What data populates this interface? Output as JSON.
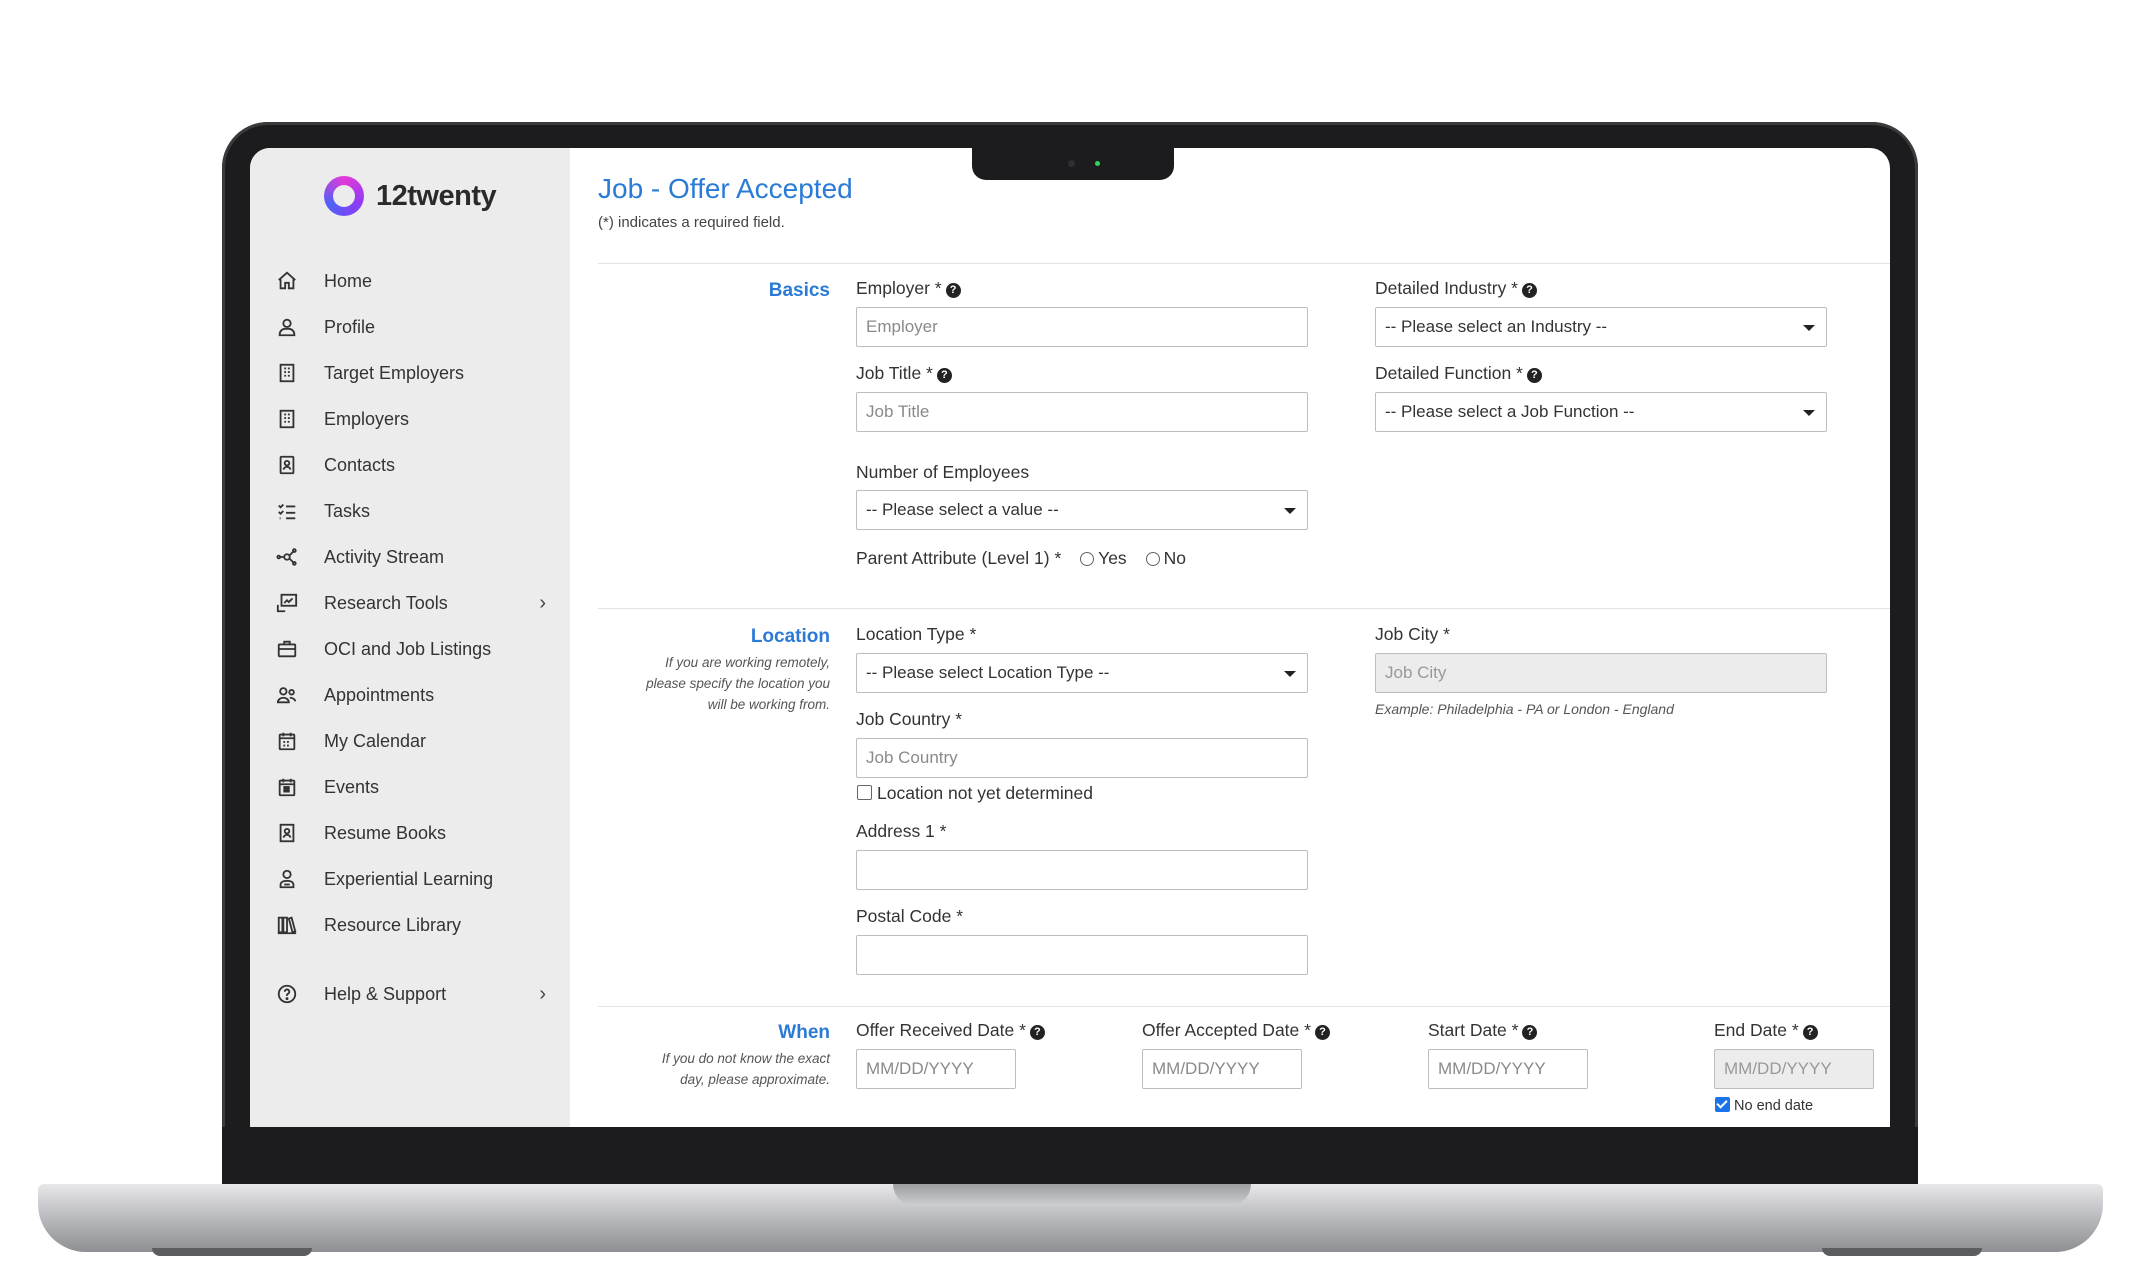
{
  "app": {
    "logo_text": "12twenty"
  },
  "sidebar": {
    "items": [
      {
        "label": "Home",
        "icon": "home-icon"
      },
      {
        "label": "Profile",
        "icon": "user-icon"
      },
      {
        "label": "Target Employers",
        "icon": "building-icon"
      },
      {
        "label": "Employers",
        "icon": "building-icon"
      },
      {
        "label": "Contacts",
        "icon": "contact-card-icon"
      },
      {
        "label": "Tasks",
        "icon": "task-list-icon"
      },
      {
        "label": "Activity Stream",
        "icon": "network-icon"
      },
      {
        "label": "Research Tools",
        "icon": "chart-screen-icon",
        "has_submenu": true
      },
      {
        "label": "OCI and Job Listings",
        "icon": "briefcase-icon"
      },
      {
        "label": "Appointments",
        "icon": "people-icon"
      },
      {
        "label": "My Calendar",
        "icon": "calendar-icon"
      },
      {
        "label": "Events",
        "icon": "calendar-star-icon"
      },
      {
        "label": "Resume Books",
        "icon": "book-user-icon"
      },
      {
        "label": "Experiential Learning",
        "icon": "user-badge-icon"
      },
      {
        "label": "Resource Library",
        "icon": "library-icon"
      }
    ],
    "help": {
      "label": "Help & Support",
      "icon": "help-circle-icon",
      "has_submenu": true
    }
  },
  "page": {
    "title": "Job - Offer Accepted",
    "required_note": "(*) indicates a required field."
  },
  "basics": {
    "section_label": "Basics",
    "employer_label": "Employer *",
    "employer_placeholder": "Employer",
    "job_title_label": "Job Title *",
    "job_title_placeholder": "Job Title",
    "num_employees_label": "Number of Employees",
    "num_employees_value": "-- Please select a value --",
    "parent_attr_label": "Parent Attribute (Level 1) *",
    "radio_yes": "Yes",
    "radio_no": "No",
    "industry_label": "Detailed Industry *",
    "industry_value": "-- Please select an Industry --",
    "function_label": "Detailed Function *",
    "function_value": "-- Please select a Job Function --"
  },
  "location": {
    "section_label": "Location",
    "help_line1": "If you are working remotely,",
    "help_line2": "please specify the location you",
    "help_line3": "will be working from.",
    "location_type_label": "Location Type *",
    "location_type_value": "-- Please select Location Type --",
    "country_label": "Job Country *",
    "country_placeholder": "Job Country",
    "not_determined_label": "Location not yet determined",
    "address_label": "Address 1 *",
    "address_value": "",
    "postal_label": "Postal Code *",
    "postal_value": "",
    "city_label": "Job City *",
    "city_placeholder": "Job City",
    "city_example": "Example: Philadelphia - PA  or  London - England"
  },
  "when": {
    "section_label": "When",
    "help_line1": "If you do not know the exact",
    "help_line2": "day, please approximate.",
    "offer_received_label": "Offer Received Date *",
    "offer_accepted_label": "Offer Accepted Date *",
    "start_label": "Start Date *",
    "end_label": "End Date *",
    "date_placeholder": "MM/DD/YYYY",
    "no_end_date_label": "No end date",
    "no_end_date_checked": true
  }
}
